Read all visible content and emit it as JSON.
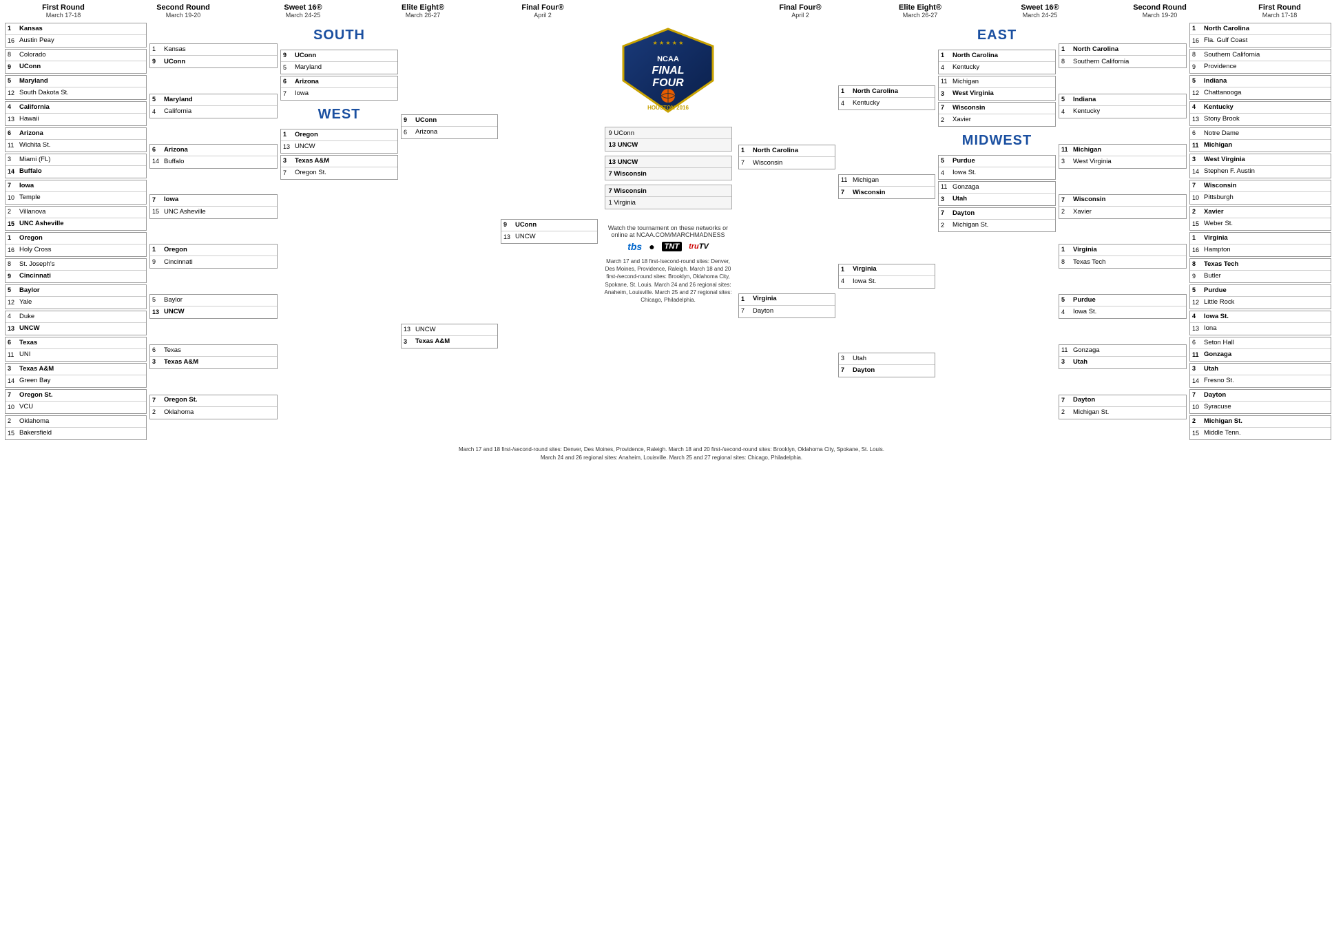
{
  "title": "NCAA March Madness Final Four Houston 2016 Bracket",
  "rounds": {
    "left": [
      {
        "name": "First Round",
        "date": "March 17-18"
      },
      {
        "name": "Second Round",
        "date": "March 19-20"
      },
      {
        "name": "Sweet 16®",
        "date": "March 24-25"
      },
      {
        "name": "Elite Eight®",
        "date": "March 26-27"
      },
      {
        "name": "Final Four®",
        "date": "April 2"
      }
    ],
    "right": [
      {
        "name": "Final Four®",
        "date": "April 2"
      },
      {
        "name": "Elite Eight®",
        "date": "March 26-27"
      },
      {
        "name": "Sweet 16®",
        "date": "March 24-25"
      },
      {
        "name": "Second Round",
        "date": "March 19-20"
      },
      {
        "name": "First Round",
        "date": "March 17-18"
      }
    ]
  },
  "regions": {
    "south_label": "SOUTH",
    "west_label": "WEST",
    "east_label": "EAST",
    "midwest_label": "MIDWEST"
  },
  "south_r1": [
    [
      {
        "seed": "1",
        "team": "Kansas",
        "w": true
      },
      {
        "seed": "16",
        "team": "Austin Peay",
        "w": false
      }
    ],
    [
      {
        "seed": "8",
        "team": "Colorado",
        "w": false
      },
      {
        "seed": "9",
        "team": "UConn",
        "w": true
      }
    ],
    [
      {
        "seed": "5",
        "team": "Maryland",
        "w": true
      },
      {
        "seed": "12",
        "team": "South Dakota St.",
        "w": false
      }
    ],
    [
      {
        "seed": "4",
        "team": "California",
        "w": true
      },
      {
        "seed": "13",
        "team": "Hawaii",
        "w": false
      }
    ],
    [
      {
        "seed": "6",
        "team": "Arizona",
        "w": true
      },
      {
        "seed": "11",
        "team": "Wichita St.",
        "w": false
      }
    ],
    [
      {
        "seed": "3",
        "team": "Miami (FL)",
        "w": false
      },
      {
        "seed": "14",
        "team": "Buffalo",
        "w": true
      }
    ],
    [
      {
        "seed": "7",
        "team": "Iowa",
        "w": true
      },
      {
        "seed": "10",
        "team": "Temple",
        "w": false
      }
    ],
    [
      {
        "seed": "2",
        "team": "Villanova",
        "w": false
      },
      {
        "seed": "15",
        "team": "UNC Asheville",
        "w": true
      }
    ]
  ],
  "south_r2": [
    [
      {
        "seed": "1",
        "team": "Kansas",
        "w": false
      },
      {
        "seed": "9",
        "team": "UConn",
        "w": true
      }
    ],
    [
      {
        "seed": "5",
        "team": "Maryland",
        "w": true
      },
      {
        "seed": "4",
        "team": "California",
        "w": false
      }
    ],
    [
      {
        "seed": "6",
        "team": "Arizona",
        "w": true
      },
      {
        "seed": "14",
        "team": "Buffalo",
        "w": false
      }
    ],
    [
      {
        "seed": "7",
        "team": "Iowa",
        "w": true
      },
      {
        "seed": "15",
        "team": "UNC Asheville",
        "w": false
      }
    ]
  ],
  "south_r3": [
    [
      {
        "seed": "9",
        "team": "UConn",
        "w": true
      },
      {
        "seed": "5",
        "team": "Maryland",
        "w": false
      }
    ],
    [
      {
        "seed": "6",
        "team": "Arizona",
        "w": true
      },
      {
        "seed": "7",
        "team": "Iowa",
        "w": false
      }
    ]
  ],
  "south_r4": [
    [
      {
        "seed": "9",
        "team": "UConn",
        "w": true
      },
      {
        "seed": "6",
        "team": "Arizona",
        "w": false
      }
    ]
  ],
  "west_r1": [
    [
      {
        "seed": "1",
        "team": "Oregon",
        "w": true
      },
      {
        "seed": "16",
        "team": "Holy Cross",
        "w": false
      }
    ],
    [
      {
        "seed": "8",
        "team": "St. Joseph's",
        "w": false
      },
      {
        "seed": "9",
        "team": "Cincinnati",
        "w": true
      }
    ],
    [
      {
        "seed": "5",
        "team": "Baylor",
        "w": true
      },
      {
        "seed": "12",
        "team": "Yale",
        "w": false
      }
    ],
    [
      {
        "seed": "4",
        "team": "Duke",
        "w": false
      },
      {
        "seed": "13",
        "team": "UNCW",
        "w": true
      }
    ],
    [
      {
        "seed": "6",
        "team": "Texas",
        "w": true
      },
      {
        "seed": "11",
        "team": "UNI",
        "w": false
      }
    ],
    [
      {
        "seed": "3",
        "team": "Texas A&M",
        "w": true
      },
      {
        "seed": "14",
        "team": "Green Bay",
        "w": false
      }
    ],
    [
      {
        "seed": "7",
        "team": "Oregon St.",
        "w": true
      },
      {
        "seed": "10",
        "team": "VCU",
        "w": false
      }
    ],
    [
      {
        "seed": "2",
        "team": "Oklahoma",
        "w": false
      },
      {
        "seed": "15",
        "team": "Bakersfield",
        "w": true
      }
    ]
  ],
  "west_r2": [
    [
      {
        "seed": "1",
        "team": "Oregon",
        "w": true
      },
      {
        "seed": "9",
        "team": "Cincinnati",
        "w": false
      }
    ],
    [
      {
        "seed": "5",
        "team": "Baylor",
        "w": false
      },
      {
        "seed": "13",
        "team": "UNCW",
        "w": true
      }
    ],
    [
      {
        "seed": "6",
        "team": "Texas",
        "w": false
      },
      {
        "seed": "3",
        "team": "Texas A&M",
        "w": true
      }
    ],
    [
      {
        "seed": "7",
        "team": "Oregon St.",
        "w": true
      },
      {
        "seed": "2",
        "team": "Oklahoma",
        "w": false
      }
    ]
  ],
  "west_r3": [
    [
      {
        "seed": "1",
        "team": "Oregon",
        "w": true
      },
      {
        "seed": "13",
        "team": "UNCW",
        "w": false
      }
    ],
    [
      {
        "seed": "3",
        "team": "Texas A&M",
        "w": true
      },
      {
        "seed": "7",
        "team": "Oregon St.",
        "w": false
      }
    ]
  ],
  "west_r4": [
    [
      {
        "seed": "13",
        "team": "UNCW",
        "w": false
      },
      {
        "seed": "3",
        "team": "Texas A&M",
        "w": true
      }
    ]
  ],
  "south_ff": [
    [
      {
        "seed": "9",
        "team": "UConn",
        "w": true
      },
      {
        "seed": "13",
        "team": "UNCW",
        "w": false
      }
    ]
  ],
  "final_four_left": [
    [
      {
        "seed": "",
        "team": "1 North Carolina",
        "w": true
      },
      {
        "seed": "",
        "team": "7 Wisconsin",
        "w": false
      }
    ],
    [
      {
        "seed": "",
        "team": "1 Virginia",
        "w": true
      },
      {
        "seed": "",
        "team": "7 Dayton",
        "w": false
      }
    ]
  ],
  "championship": [
    [
      {
        "seed": "",
        "team": "13 UNCW",
        "w": false
      },
      {
        "seed": "",
        "team": "7 Wisconsin",
        "w": true
      }
    ],
    [
      {
        "seed": "",
        "team": "7 Wisconsin",
        "w": true
      },
      {
        "seed": "",
        "team": "1 Virginia",
        "w": false
      }
    ]
  ],
  "east_r1": [
    [
      {
        "seed": "1",
        "team": "North Carolina",
        "w": true
      },
      {
        "seed": "16",
        "team": "Fla. Gulf Coast",
        "w": false
      }
    ],
    [
      {
        "seed": "8",
        "team": "Southern California",
        "w": false
      },
      {
        "seed": "9",
        "team": "Providence",
        "w": true
      }
    ],
    [
      {
        "seed": "5",
        "team": "Indiana",
        "w": true
      },
      {
        "seed": "12",
        "team": "Chattanooga",
        "w": false
      }
    ],
    [
      {
        "seed": "4",
        "team": "Kentucky",
        "w": true
      },
      {
        "seed": "13",
        "team": "Stony Brook",
        "w": false
      }
    ],
    [
      {
        "seed": "6",
        "team": "Notre Dame",
        "w": false
      },
      {
        "seed": "11",
        "team": "Michigan",
        "w": true
      }
    ],
    [
      {
        "seed": "3",
        "team": "West Virginia",
        "w": true
      },
      {
        "seed": "14",
        "team": "Stephen F. Austin",
        "w": false
      }
    ],
    [
      {
        "seed": "7",
        "team": "Wisconsin",
        "w": true
      },
      {
        "seed": "10",
        "team": "Pittsburgh",
        "w": false
      }
    ],
    [
      {
        "seed": "2",
        "team": "Xavier",
        "w": true
      },
      {
        "seed": "15",
        "team": "Weber St.",
        "w": false
      }
    ]
  ],
  "east_r2": [
    [
      {
        "seed": "1",
        "team": "North Carolina",
        "w": true
      },
      {
        "seed": "8",
        "team": "Southern California",
        "w": false
      }
    ],
    [
      {
        "seed": "5",
        "team": "Indiana",
        "w": true
      },
      {
        "seed": "4",
        "team": "Kentucky",
        "w": false
      }
    ],
    [
      {
        "seed": "11",
        "team": "Michigan",
        "w": true
      },
      {
        "seed": "3",
        "team": "West Virginia",
        "w": false
      }
    ],
    [
      {
        "seed": "7",
        "team": "Wisconsin",
        "w": true
      },
      {
        "seed": "2",
        "team": "Xavier",
        "w": false
      }
    ]
  ],
  "east_r3": [
    [
      {
        "seed": "1",
        "team": "North Carolina",
        "w": true
      },
      {
        "seed": "4",
        "team": "Kentucky",
        "w": false
      }
    ],
    [
      {
        "seed": "11",
        "team": "Michigan",
        "w": false
      },
      {
        "seed": "7",
        "team": "Wisconsin",
        "w": true
      }
    ]
  ],
  "east_r4": [
    [
      {
        "seed": "1",
        "team": "North Carolina",
        "w": true
      },
      {
        "seed": "7",
        "team": "Wisconsin",
        "w": false
      }
    ]
  ],
  "midwest_r1": [
    [
      {
        "seed": "1",
        "team": "Virginia",
        "w": true
      },
      {
        "seed": "16",
        "team": "Hampton",
        "w": false
      }
    ],
    [
      {
        "seed": "8",
        "team": "Texas Tech",
        "w": true
      },
      {
        "seed": "9",
        "team": "Butler",
        "w": false
      }
    ],
    [
      {
        "seed": "5",
        "team": "Purdue",
        "w": true
      },
      {
        "seed": "12",
        "team": "Little Rock",
        "w": false
      }
    ],
    [
      {
        "seed": "4",
        "team": "Iowa St.",
        "w": true
      },
      {
        "seed": "13",
        "team": "Iona",
        "w": false
      }
    ],
    [
      {
        "seed": "6",
        "team": "Seton Hall",
        "w": false
      },
      {
        "seed": "11",
        "team": "Gonzaga",
        "w": true
      }
    ],
    [
      {
        "seed": "3",
        "team": "Utah",
        "w": true
      },
      {
        "seed": "14",
        "team": "Fresno St.",
        "w": false
      }
    ],
    [
      {
        "seed": "7",
        "team": "Dayton",
        "w": true
      },
      {
        "seed": "10",
        "team": "Syracuse",
        "w": false
      }
    ],
    [
      {
        "seed": "2",
        "team": "Michigan St.",
        "w": true
      },
      {
        "seed": "15",
        "team": "Middle Tenn.",
        "w": false
      }
    ]
  ],
  "midwest_r2": [
    [
      {
        "seed": "1",
        "team": "Virginia",
        "w": true
      },
      {
        "seed": "8",
        "team": "Texas Tech",
        "w": false
      }
    ],
    [
      {
        "seed": "5",
        "team": "Purdue",
        "w": true
      },
      {
        "seed": "4",
        "team": "Iowa St.",
        "w": false
      }
    ],
    [
      {
        "seed": "11",
        "team": "Gonzaga",
        "w": false
      },
      {
        "seed": "3",
        "team": "Utah",
        "w": true
      }
    ],
    [
      {
        "seed": "7",
        "team": "Dayton",
        "w": true
      },
      {
        "seed": "2",
        "team": "Michigan St.",
        "w": false
      }
    ]
  ],
  "midwest_r3": [
    [
      {
        "seed": "1",
        "team": "Virginia",
        "w": true
      },
      {
        "seed": "4",
        "team": "Iowa St.",
        "w": false
      }
    ],
    [
      {
        "seed": "3",
        "team": "Utah",
        "w": true
      },
      {
        "seed": "7",
        "team": "Dayton",
        "w": false
      }
    ]
  ],
  "midwest_r4": [
    [
      {
        "seed": "1",
        "team": "Virginia",
        "w": true
      },
      {
        "seed": "7",
        "team": "Dayton",
        "w": false
      }
    ]
  ],
  "networks_text": "Watch the tournament on these networks\nor online at NCAA.COM/MARCHMADNESS",
  "footnote": "March 17 and 18 first-/second-round sites: Denver, Des Moines, Providence, Raleigh. March 18 and 20 first-/second-round sites: Brooklyn, Oklahoma City, Spokane, St. Louis.\nMarch 24 and 26 regional sites: Anaheim, Louisville. March 25 and 27 regional sites: Chicago, Philadelphia.",
  "network_labels": {
    "tbs": "tbs",
    "cbs": "CBS",
    "tnt": "TNT",
    "trutv": "truTV"
  }
}
